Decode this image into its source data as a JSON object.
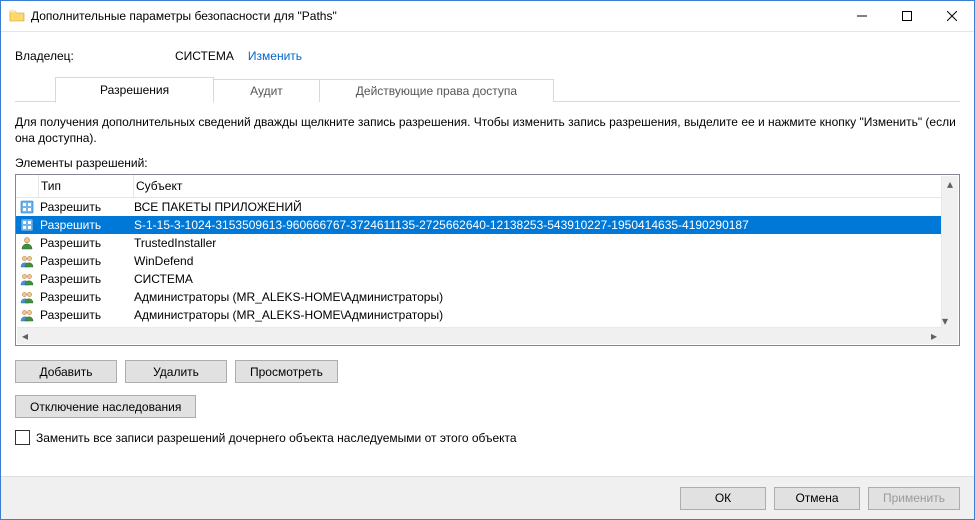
{
  "window": {
    "title": "Дополнительные параметры безопасности  для \"Paths\""
  },
  "owner": {
    "label": "Владелец:",
    "value": "СИСТЕМА",
    "change": "Изменить"
  },
  "tabs": {
    "permissions": "Разрешения",
    "audit": "Аудит",
    "effective": "Действующие права доступа"
  },
  "info": "Для получения дополнительных сведений дважды щелкните запись разрешения. Чтобы изменить запись разрешения, выделите ее и нажмите кнопку \"Изменить\" (если она доступна).",
  "elements_label": "Элементы разрешений:",
  "columns": {
    "type": "Тип",
    "subject": "Субъект"
  },
  "rows": [
    {
      "icon": "app-package",
      "type": "Разрешить",
      "subject": "ВСЕ ПАКЕТЫ ПРИЛОЖЕНИЙ",
      "selected": false
    },
    {
      "icon": "app-package",
      "type": "Разрешить",
      "subject": "S-1-15-3-1024-3153509613-960666767-3724611135-2725662640-12138253-543910227-1950414635-4190290187",
      "selected": true
    },
    {
      "icon": "user",
      "type": "Разрешить",
      "subject": "TrustedInstaller",
      "selected": false
    },
    {
      "icon": "group",
      "type": "Разрешить",
      "subject": "WinDefend",
      "selected": false
    },
    {
      "icon": "group",
      "type": "Разрешить",
      "subject": "СИСТЕМА",
      "selected": false
    },
    {
      "icon": "group",
      "type": "Разрешить",
      "subject": "Администраторы (MR_ALEKS-HOME\\Администраторы)",
      "selected": false
    },
    {
      "icon": "group",
      "type": "Разрешить",
      "subject": "Администраторы (MR_ALEKS-HOME\\Администраторы)",
      "selected": false
    }
  ],
  "buttons": {
    "add": "Добавить",
    "remove": "Удалить",
    "view": "Просмотреть",
    "disable_inherit": "Отключение наследования",
    "ok": "ОК",
    "cancel": "Отмена",
    "apply": "Применить"
  },
  "replace_label": "Заменить все записи разрешений дочернего объекта наследуемыми от этого объекта"
}
